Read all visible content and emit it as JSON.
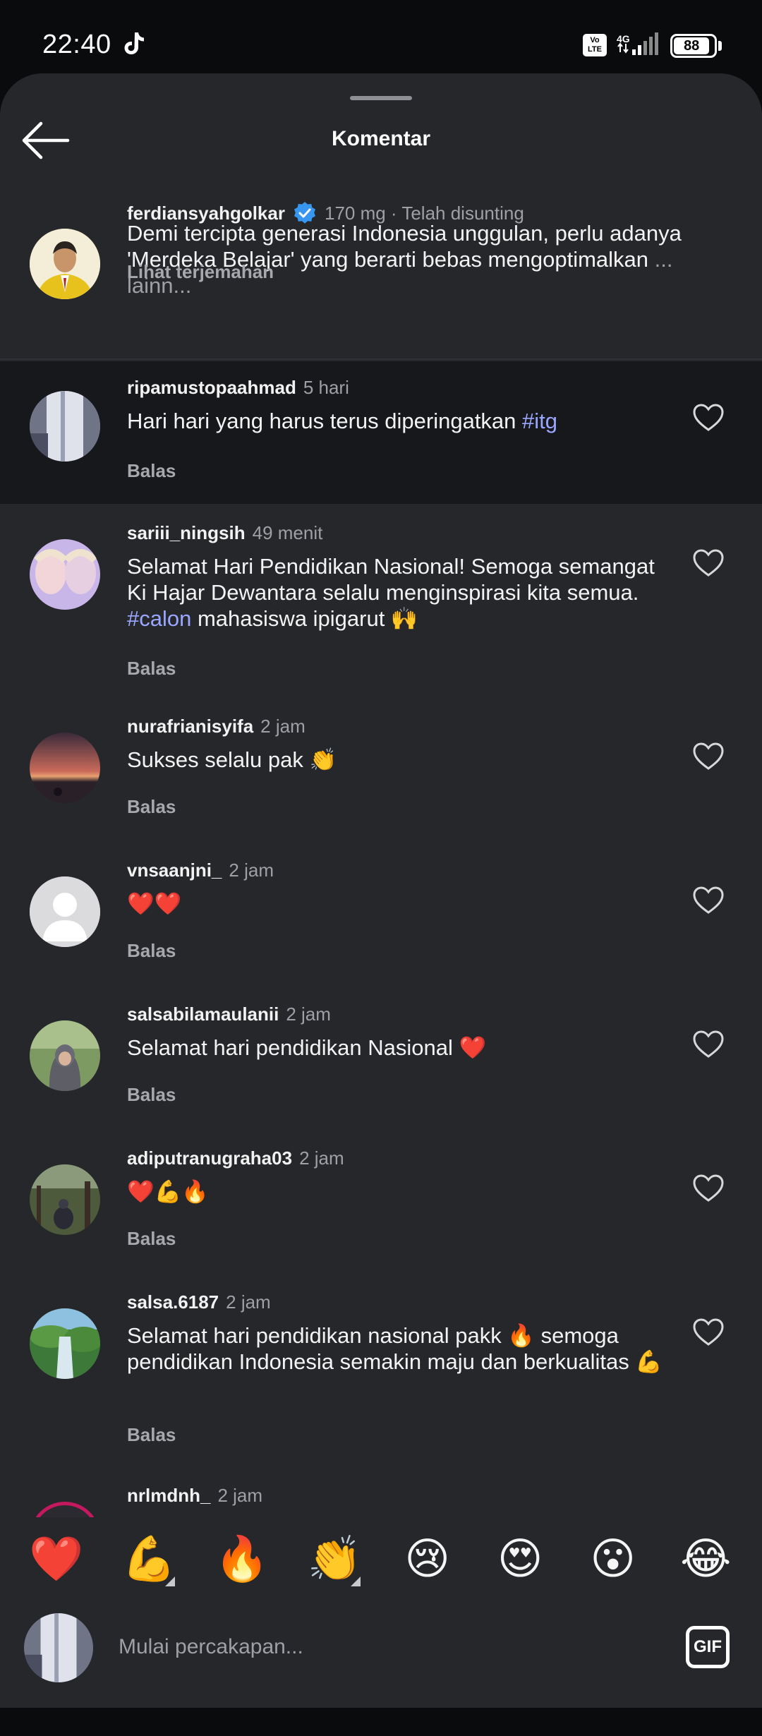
{
  "status_bar": {
    "time": "22:40",
    "volte": "Vo LTE",
    "network": "4G",
    "battery": "88"
  },
  "header": {
    "title": "Komentar"
  },
  "caption": {
    "username": "ferdiansyahgolkar",
    "verified": true,
    "meta": "170 mg · Telah disunting",
    "text": "Demi tercipta generasi Indonesia unggulan, perlu adanya 'Merdeka Belajar' yang berarti bebas mengoptimalkan",
    "more": "... lainn...",
    "translate": "Lihat terjemahan"
  },
  "comments": [
    {
      "username": "ripamustopaahmad",
      "time": "5 hari",
      "text": "Hari hari yang harus terus diperingatkan ",
      "hashtag": "#itg",
      "reply": "Balas"
    },
    {
      "username": "sariii_ningsih",
      "time": "49 menit",
      "text_a": "Selamat Hari Pendidikan Nasional! Semoga semangat Ki Hajar Dewantara selalu menginspirasi kita semua. ",
      "hashtag": "#calon",
      "text_b": " mahasiswa ipigarut 🙌",
      "reply": "Balas"
    },
    {
      "username": "nurafrianisyifa",
      "time": "2 jam",
      "text": "Sukses selalu pak 👏",
      "reply": "Balas"
    },
    {
      "username": "vnsaanjni_",
      "time": "2 jam",
      "text": "❤️❤️",
      "reply": "Balas"
    },
    {
      "username": "salsabilamaulanii",
      "time": "2 jam",
      "text": "Selamat hari pendidikan Nasional ❤️",
      "reply": "Balas"
    },
    {
      "username": "adiputranugraha03",
      "time": "2 jam",
      "text": "❤️💪🔥",
      "reply": "Balas"
    },
    {
      "username": "salsa.6187",
      "time": "2 jam",
      "text": "Selamat hari pendidikan nasional pakk 🔥 semoga pendidikan Indonesia semakin maju dan berkualitas 💪",
      "reply": "Balas"
    },
    {
      "username": "nrlmdnh_",
      "time": "2 jam"
    }
  ],
  "emoji_bar": [
    "❤️",
    "💪",
    "🔥",
    "👏",
    "😢",
    "😍",
    "😮",
    "😂"
  ],
  "compose": {
    "placeholder": "Mulai percakapan...",
    "gif_label": "GIF"
  },
  "colors": {
    "sheet_bg": "#25272b",
    "highlight_bg": "#17181b",
    "hashtag": "#9aa6ff",
    "verified": "#3797f0"
  }
}
